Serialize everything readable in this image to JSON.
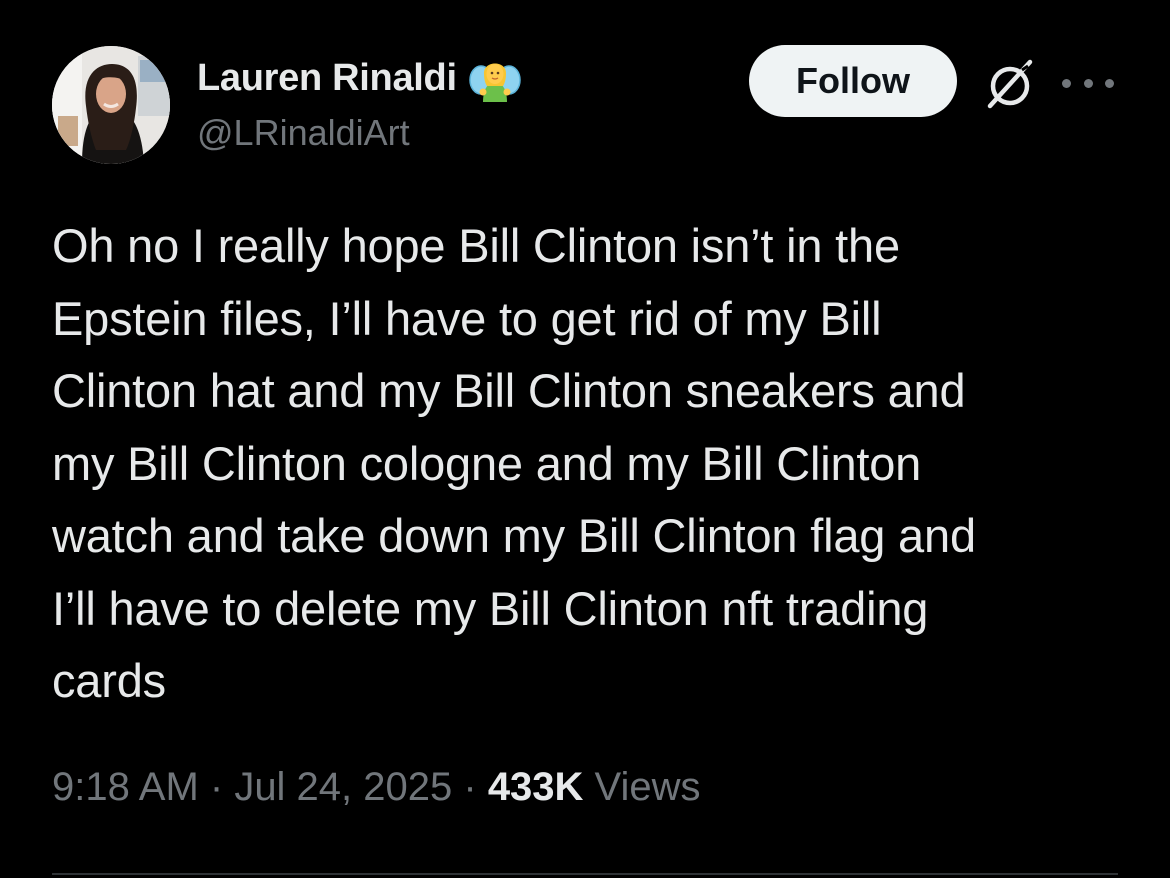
{
  "author": {
    "display_name": "Lauren Rinaldi",
    "name_emoji": "fairy-emoji",
    "handle": "@LRinaldiArt",
    "avatar": "profile-photo"
  },
  "actions": {
    "follow_label": "Follow",
    "grok_icon": "grok-icon",
    "more_icon": "more-icon"
  },
  "post": {
    "text": "Oh no I really hope Bill Clinton isn’t in the\nEpstein files, I’ll have to get rid of my Bill\nClinton hat and my Bill Clinton sneakers and\nmy Bill Clinton cologne and my Bill Clinton\nwatch and take down my Bill Clinton flag and\nI’ll have to delete my Bill Clinton nft trading\ncards"
  },
  "meta": {
    "time": "9:18 AM",
    "separator": " · ",
    "date": "Jul 24, 2025",
    "views_count": "433K",
    "views_label": " Views"
  },
  "colors": {
    "background": "#000000",
    "text_primary": "#e7e9ea",
    "text_secondary": "#71767b",
    "follow_bg": "#eff3f4",
    "divider": "#2f3336"
  }
}
